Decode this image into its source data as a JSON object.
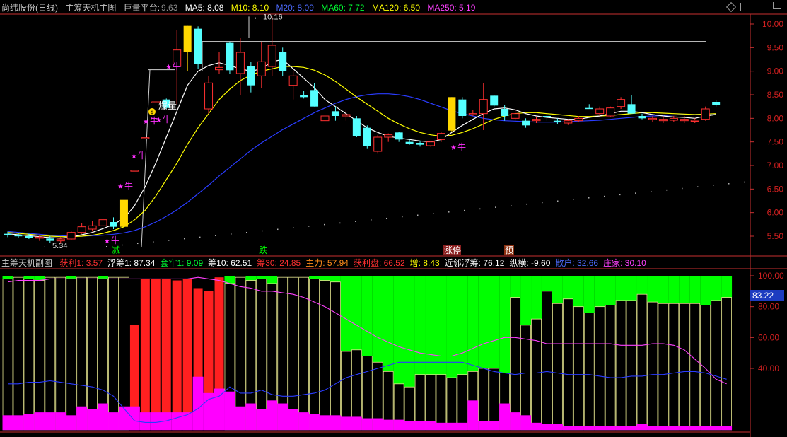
{
  "main_header": {
    "title": "尚纬股份(日线)",
    "indicator": "主筹天机主图",
    "platform_label": "巨量平台:",
    "platform_value": "9.63",
    "ma5": "MA5: 8.08",
    "ma10": "M10: 8.10",
    "ma20": "M20: 8.09",
    "ma60": "MA60: 7.72",
    "ma120": "MA120: 6.50",
    "ma250": "MA250: 5.19"
  },
  "sub_header": {
    "indicator": "主筹天机副图",
    "items": [
      {
        "text": "获利1: 3.57",
        "color": "#ff3030"
      },
      {
        "text": "浮筹1: 87.34",
        "color": "#ffffff"
      },
      {
        "text": "套牢1: 9.09",
        "color": "#00ff33"
      },
      {
        "text": "筹10: 62.51",
        "color": "#ffffff"
      },
      {
        "text": "筹30: 24.85",
        "color": "#ff3030"
      },
      {
        "text": "主力: 57.94",
        "color": "#ff8c1a"
      },
      {
        "text": "获利盘: 66.52",
        "color": "#ff3030"
      },
      {
        "text": "增: 8.43",
        "color": "#ffff00"
      },
      {
        "text": "近邻浮筹: 76.12",
        "color": "#ffffff"
      },
      {
        "text": "纵横: -9.60",
        "color": "#ffffff"
      },
      {
        "text": "散户: 32.66",
        "color": "#4d6bff"
      },
      {
        "text": "庄家: 30.10",
        "color": "#ff40ff"
      }
    ]
  },
  "labels": {
    "high": "10.16",
    "low": "5.34",
    "explode": "爆量",
    "jian": "减",
    "die": "跌",
    "zhangting": "涨停",
    "yu": "预",
    "niu": "牛",
    "sub_current": "83.22"
  },
  "colors": {
    "up": "#ff3030",
    "down": "#54ffff",
    "yellow_bar": "#ffd700",
    "ma5": "#ffffff",
    "ma10": "#ffff00",
    "ma20": "#2a3cff",
    "green_fill": "#00ff00",
    "red_fill": "#ff2020",
    "magenta_fill": "#ff00ff",
    "axis": "#c83030"
  },
  "chart_data": [
    {
      "type": "candlestick",
      "ylim": [
        5.2,
        10.3
      ],
      "y_ticks": [
        5.5,
        6.0,
        6.5,
        7.0,
        7.5,
        8.0,
        8.5,
        9.0,
        9.5,
        10.0
      ],
      "candles": [
        {
          "o": 5.55,
          "h": 5.6,
          "l": 5.48,
          "c": 5.52
        },
        {
          "o": 5.52,
          "h": 5.56,
          "l": 5.46,
          "c": 5.5
        },
        {
          "o": 5.5,
          "h": 5.55,
          "l": 5.44,
          "c": 5.46
        },
        {
          "o": 5.46,
          "h": 5.52,
          "l": 5.4,
          "c": 5.48
        },
        {
          "o": 5.45,
          "h": 5.5,
          "l": 5.36,
          "c": 5.4
        },
        {
          "o": 5.4,
          "h": 5.48,
          "l": 5.34,
          "c": 5.44
        },
        {
          "o": 5.44,
          "h": 5.62,
          "l": 5.42,
          "c": 5.58
        },
        {
          "o": 5.58,
          "h": 5.78,
          "l": 5.55,
          "c": 5.7
        },
        {
          "o": 5.65,
          "h": 5.82,
          "l": 5.6,
          "c": 5.72
        },
        {
          "o": 5.72,
          "h": 5.88,
          "l": 5.68,
          "c": 5.85
        },
        {
          "o": 5.8,
          "h": 5.9,
          "l": 5.65,
          "c": 5.7
        },
        {
          "o": 5.7,
          "h": 6.27,
          "l": 5.68,
          "c": 6.27,
          "hl": true
        },
        {
          "o": 6.9,
          "h": 6.9,
          "l": 6.9,
          "c": 6.9
        },
        {
          "o": 7.59,
          "h": 7.59,
          "l": 7.59,
          "c": 7.59
        },
        {
          "o": 8.35,
          "h": 8.35,
          "l": 8.35,
          "c": 8.35
        },
        {
          "o": 8.4,
          "h": 8.42,
          "l": 8.2,
          "c": 8.22
        },
        {
          "o": 9.1,
          "h": 9.88,
          "l": 8.3,
          "c": 9.45
        },
        {
          "o": 9.4,
          "h": 9.96,
          "l": 9.0,
          "c": 9.96,
          "hl": true
        },
        {
          "o": 9.9,
          "h": 9.95,
          "l": 9.05,
          "c": 9.15
        },
        {
          "o": 8.2,
          "h": 8.9,
          "l": 8.1,
          "c": 8.75
        },
        {
          "o": 9.03,
          "h": 9.4,
          "l": 8.95,
          "c": 9.08
        },
        {
          "o": 9.6,
          "h": 9.62,
          "l": 8.95,
          "c": 9.02
        },
        {
          "o": 8.95,
          "h": 9.7,
          "l": 8.5,
          "c": 9.4
        },
        {
          "o": 9.1,
          "h": 9.2,
          "l": 8.55,
          "c": 8.7
        },
        {
          "o": 8.9,
          "h": 9.62,
          "l": 8.65,
          "c": 9.2
        },
        {
          "o": 9.1,
          "h": 10.16,
          "l": 8.9,
          "c": 9.55
        },
        {
          "o": 9.4,
          "h": 9.5,
          "l": 8.9,
          "c": 9.0
        },
        {
          "o": 8.7,
          "h": 9.0,
          "l": 8.4,
          "c": 8.9
        },
        {
          "o": 8.5,
          "h": 8.58,
          "l": 8.42,
          "c": 8.45
        },
        {
          "o": 8.6,
          "h": 8.75,
          "l": 8.25,
          "c": 8.25
        },
        {
          "o": 7.95,
          "h": 8.05,
          "l": 7.9,
          "c": 8.05
        },
        {
          "o": 8.15,
          "h": 8.25,
          "l": 7.95,
          "c": 8.05
        },
        {
          "o": 8.05,
          "h": 8.18,
          "l": 7.95,
          "c": 8.08
        },
        {
          "o": 8.0,
          "h": 8.05,
          "l": 7.6,
          "c": 7.62
        },
        {
          "o": 7.8,
          "h": 7.85,
          "l": 7.35,
          "c": 7.42
        },
        {
          "o": 7.3,
          "h": 7.65,
          "l": 7.25,
          "c": 7.6
        },
        {
          "o": 7.6,
          "h": 7.68,
          "l": 7.5,
          "c": 7.65
        },
        {
          "o": 7.7,
          "h": 7.72,
          "l": 7.5,
          "c": 7.55
        },
        {
          "o": 7.5,
          "h": 7.55,
          "l": 7.44,
          "c": 7.46
        },
        {
          "o": 7.48,
          "h": 7.52,
          "l": 7.4,
          "c": 7.44
        },
        {
          "o": 7.42,
          "h": 7.52,
          "l": 7.4,
          "c": 7.5
        },
        {
          "o": 7.55,
          "h": 7.7,
          "l": 7.5,
          "c": 7.68
        },
        {
          "o": 7.74,
          "h": 8.45,
          "l": 7.72,
          "c": 8.45,
          "hl": true
        },
        {
          "o": 8.4,
          "h": 8.45,
          "l": 8.0,
          "c": 8.05
        },
        {
          "o": 8.08,
          "h": 8.18,
          "l": 8.05,
          "c": 8.1
        },
        {
          "o": 8.1,
          "h": 8.75,
          "l": 7.75,
          "c": 8.4
        },
        {
          "o": 8.48,
          "h": 8.5,
          "l": 8.25,
          "c": 8.27
        },
        {
          "o": 8.2,
          "h": 8.28,
          "l": 7.95,
          "c": 8.05
        },
        {
          "o": 8.0,
          "h": 8.2,
          "l": 7.95,
          "c": 8.1
        },
        {
          "o": 7.95,
          "h": 8.0,
          "l": 7.8,
          "c": 7.85
        },
        {
          "o": 7.95,
          "h": 8.02,
          "l": 7.9,
          "c": 7.98
        },
        {
          "o": 8.05,
          "h": 8.1,
          "l": 7.95,
          "c": 8.02
        },
        {
          "o": 7.95,
          "h": 8.0,
          "l": 7.88,
          "c": 7.92
        },
        {
          "o": 7.9,
          "h": 7.98,
          "l": 7.86,
          "c": 7.95
        },
        {
          "o": 7.95,
          "h": 8.05,
          "l": 7.93,
          "c": 8.0
        },
        {
          "o": 8.22,
          "h": 8.3,
          "l": 8.2,
          "c": 8.2
        },
        {
          "o": 8.1,
          "h": 8.25,
          "l": 8.05,
          "c": 8.2
        },
        {
          "o": 8.05,
          "h": 8.25,
          "l": 8.02,
          "c": 8.22
        },
        {
          "o": 8.25,
          "h": 8.45,
          "l": 8.2,
          "c": 8.4
        },
        {
          "o": 8.3,
          "h": 8.5,
          "l": 8.1,
          "c": 8.1
        },
        {
          "o": 8.05,
          "h": 8.1,
          "l": 7.98,
          "c": 8.0
        },
        {
          "o": 7.98,
          "h": 8.05,
          "l": 7.92,
          "c": 8.0
        },
        {
          "o": 7.95,
          "h": 8.05,
          "l": 7.9,
          "c": 7.98
        },
        {
          "o": 7.96,
          "h": 8.05,
          "l": 7.92,
          "c": 8.0
        },
        {
          "o": 7.95,
          "h": 8.05,
          "l": 7.9,
          "c": 7.98
        },
        {
          "o": 7.95,
          "h": 8.0,
          "l": 7.9,
          "c": 7.96
        },
        {
          "o": 7.98,
          "h": 8.25,
          "l": 7.95,
          "c": 8.2
        },
        {
          "o": 8.35,
          "h": 8.38,
          "l": 8.25,
          "c": 8.28
        }
      ],
      "ma5": [
        5.55,
        5.53,
        5.51,
        5.49,
        5.47,
        5.46,
        5.48,
        5.53,
        5.58,
        5.66,
        5.75,
        5.88,
        6.15,
        6.55,
        7.05,
        7.6,
        8.15,
        8.7,
        9.0,
        9.12,
        9.18,
        9.12,
        9.05,
        9.0,
        9.05,
        9.2,
        9.25,
        9.05,
        8.85,
        8.65,
        8.4,
        8.25,
        8.1,
        7.95,
        7.8,
        7.7,
        7.62,
        7.58,
        7.55,
        7.52,
        7.5,
        7.55,
        7.7,
        7.85,
        7.98,
        8.1,
        8.2,
        8.22,
        8.18,
        8.1,
        8.05,
        8.02,
        8.0,
        7.98,
        7.98,
        8.02,
        8.05,
        8.1,
        8.15,
        8.15,
        8.12,
        8.08,
        8.05,
        8.03,
        8.02,
        8.0,
        8.05,
        8.08
      ],
      "ma10": [
        5.58,
        5.56,
        5.54,
        5.52,
        5.5,
        5.49,
        5.49,
        5.5,
        5.52,
        5.56,
        5.62,
        5.7,
        5.85,
        6.05,
        6.35,
        6.7,
        7.05,
        7.45,
        7.8,
        8.1,
        8.4,
        8.62,
        8.8,
        8.92,
        9.0,
        9.05,
        9.1,
        9.1,
        9.08,
        9.02,
        8.92,
        8.78,
        8.62,
        8.45,
        8.3,
        8.15,
        8.0,
        7.88,
        7.78,
        7.7,
        7.65,
        7.62,
        7.64,
        7.7,
        7.78,
        7.88,
        7.98,
        8.05,
        8.1,
        8.12,
        8.12,
        8.1,
        8.08,
        8.06,
        8.04,
        8.04,
        8.05,
        8.06,
        8.08,
        8.1,
        8.12,
        8.12,
        8.11,
        8.1,
        8.09,
        8.08,
        8.09,
        8.1
      ],
      "ma20": [
        5.6,
        5.58,
        5.56,
        5.54,
        5.52,
        5.51,
        5.5,
        5.5,
        5.51,
        5.52,
        5.54,
        5.57,
        5.62,
        5.7,
        5.8,
        5.92,
        6.06,
        6.22,
        6.4,
        6.58,
        6.78,
        6.96,
        7.14,
        7.32,
        7.48,
        7.62,
        7.76,
        7.88,
        8.0,
        8.12,
        8.22,
        8.32,
        8.4,
        8.46,
        8.5,
        8.52,
        8.52,
        8.5,
        8.46,
        8.4,
        8.32,
        8.24,
        8.16,
        8.1,
        8.05,
        8.0,
        7.97,
        7.95,
        7.94,
        7.93,
        7.92,
        7.92,
        7.92,
        7.93,
        7.94,
        7.95,
        7.96,
        7.98,
        8.0,
        8.02,
        8.04,
        8.05,
        8.06,
        8.07,
        8.08,
        8.08,
        8.09,
        8.09
      ],
      "platform_line": 9.63
    },
    {
      "type": "bar",
      "ylim": [
        0,
        105
      ],
      "y_ticks": [
        40,
        60,
        80,
        100
      ],
      "bars": [
        98,
        99,
        98,
        97,
        99,
        99,
        98,
        99,
        99,
        98,
        99,
        99,
        68,
        98,
        98,
        98,
        97,
        98,
        92,
        90,
        99,
        95,
        99,
        97,
        98,
        95,
        99,
        99,
        99,
        98,
        97,
        96,
        51,
        52,
        48,
        44,
        38,
        30,
        28,
        36,
        36,
        36,
        34,
        36,
        38,
        40,
        40,
        37,
        86,
        68,
        72,
        90,
        82,
        85,
        80,
        76,
        80,
        81,
        84,
        84,
        88,
        83,
        82,
        82,
        82,
        82,
        81,
        84,
        86
      ],
      "red_bars": [
        12,
        13,
        14,
        15,
        16,
        17,
        18,
        19,
        20
      ],
      "magenta": [
        10,
        10,
        11,
        12,
        12,
        12,
        10,
        16,
        14,
        18,
        12,
        16,
        16,
        12,
        12,
        12,
        12,
        12,
        36,
        25,
        28,
        26,
        16,
        18,
        14,
        20,
        18,
        14,
        12,
        11,
        10,
        10,
        9,
        9,
        8,
        8,
        7,
        7,
        6,
        6,
        6,
        5,
        5,
        5,
        20,
        6,
        6,
        18,
        12,
        10,
        5,
        4,
        4,
        3,
        3,
        3,
        3,
        3,
        3,
        3,
        4,
        3,
        3,
        3,
        3,
        3,
        3,
        3,
        3
      ],
      "pink_line": [
        96,
        97,
        97,
        97,
        98,
        98,
        98,
        98,
        98,
        98,
        98,
        98,
        98,
        98,
        98,
        98,
        98,
        98,
        99,
        98,
        97,
        95,
        93,
        92,
        90,
        90,
        89,
        88,
        86,
        83,
        80,
        76,
        72,
        68,
        64,
        60,
        57,
        54,
        52,
        50,
        49,
        48,
        48,
        50,
        53,
        56,
        58,
        60,
        60,
        59,
        58,
        56,
        56,
        56,
        56,
        56,
        56,
        56,
        55,
        55,
        55,
        56,
        56,
        55,
        52,
        46,
        40,
        33,
        30
      ],
      "blue_line": [
        30,
        30,
        31,
        31,
        32,
        31,
        30,
        29,
        28,
        26,
        22,
        14,
        6,
        5,
        5,
        6,
        8,
        10,
        14,
        20,
        22,
        28,
        24,
        24,
        26,
        23,
        22,
        22,
        23,
        24,
        26,
        30,
        34,
        36,
        38,
        40,
        42,
        44,
        44,
        44,
        44,
        44,
        44,
        44,
        42,
        40,
        38,
        37,
        36,
        37,
        37,
        38,
        37,
        36,
        36,
        36,
        35,
        34,
        34,
        35,
        35,
        36,
        36,
        37,
        38,
        38,
        37,
        35,
        33
      ]
    }
  ]
}
